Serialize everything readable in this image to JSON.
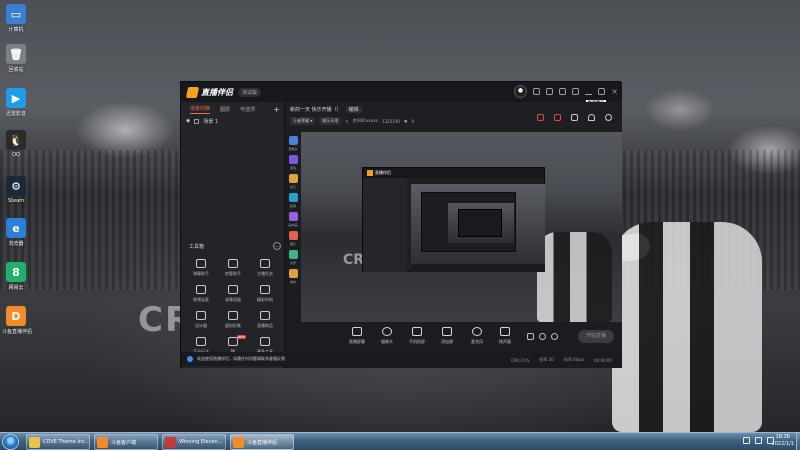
{
  "desktop": {
    "wall_text": "CRI",
    "icons": [
      {
        "label": "计算机",
        "icon": "computer-icon",
        "color": "#3b7fd4",
        "glyph": "▭"
      },
      {
        "label": "回收站",
        "icon": "recycle-bin-icon",
        "color": "#7a8088",
        "glyph": "🗑"
      },
      {
        "label": "迅雷影音",
        "icon": "media-player-icon",
        "color": "#1e9be9",
        "glyph": "▶"
      },
      {
        "label": "QQ",
        "icon": "qq-icon",
        "color": "#2b2b2b",
        "glyph": "🐧"
      },
      {
        "label": "Steam",
        "icon": "steam-icon",
        "color": "#1b2838",
        "glyph": "⚙"
      },
      {
        "label": "浏览器",
        "icon": "browser-icon",
        "color": "#2a7fd9",
        "glyph": "e"
      },
      {
        "label": "网易云",
        "icon": "netease-icon",
        "color": "#23b06b",
        "glyph": "8"
      },
      {
        "label": "斗鱼直播伴侣",
        "icon": "douyu-icon",
        "color": "#f28c28",
        "glyph": "D"
      }
    ]
  },
  "app": {
    "title": "直播伴侣",
    "version_badge": "测试版",
    "mini_badge": "新手提示",
    "accent": "#f06a5a",
    "left_tabs": [
      {
        "label": "场景切换",
        "active": true
      },
      {
        "label": "图层",
        "active": false
      },
      {
        "label": "可选项",
        "active": false
      }
    ],
    "scene_label": "场景 1",
    "tools_title": "工具箱",
    "tools": [
      {
        "label": "弹幕助手",
        "icon": "danmaku-icon"
      },
      {
        "label": "房管助手",
        "icon": "admin-icon"
      },
      {
        "label": "主播任务",
        "icon": "task-icon"
      },
      {
        "label": "视频连麦",
        "icon": "video-link-icon"
      },
      {
        "label": "录像回放",
        "icon": "replay-icon"
      },
      {
        "label": "精彩时刻",
        "icon": "highlight-icon"
      },
      {
        "label": "设计器",
        "icon": "designer-icon"
      },
      {
        "label": "虚拟形象",
        "icon": "avatar-tool-icon"
      },
      {
        "label": "直播商品",
        "icon": "goods-icon"
      },
      {
        "label": "互动玩法",
        "icon": "game-tool-icon"
      },
      {
        "label": "PK",
        "icon": "pk-icon",
        "badge": "NEW"
      },
      {
        "label": "更多工具",
        "icon": "more-tools-icon"
      }
    ],
    "notice": "欢迎使用直播伴侣，如遇任何问题请联系客服反馈",
    "room_title": "新的一天 快乐开播（）",
    "edit_label": "编辑",
    "room_chips": [
      "王者荣耀 ▾",
      "娱乐天地"
    ],
    "room_id": "房间ID:xxxxx",
    "fans": "1325190",
    "likes": "0",
    "preview_text": "CRI",
    "sources": [
      {
        "label": "摄像头",
        "color": "#4a7fe0"
      },
      {
        "label": "游戏",
        "color": "#7b59e0"
      },
      {
        "label": "窗口",
        "color": "#e0a43a"
      },
      {
        "label": "投屏",
        "color": "#2aa0c9"
      },
      {
        "label": "画中画",
        "color": "#9a5ee0"
      },
      {
        "label": "图片",
        "color": "#e2644c"
      },
      {
        "label": "文字",
        "color": "#3db38a"
      },
      {
        "label": "素材",
        "color": "#d9a23a"
      }
    ],
    "controls": [
      {
        "label": "直播屏幕",
        "icon": "screen-icon"
      },
      {
        "label": "摄像头",
        "icon": "camera-icon"
      },
      {
        "label": "手机投屏",
        "icon": "phone-cast-icon"
      },
      {
        "label": "添加源",
        "icon": "add-source-icon"
      },
      {
        "label": "麦克风",
        "icon": "microphone-icon"
      },
      {
        "label": "扬声器",
        "icon": "speaker-icon"
      }
    ],
    "start_label": "开始直播",
    "status": [
      "CPU:21%",
      "帧率:30",
      "码率:0kb/s",
      "00:00:00"
    ]
  },
  "taskbar": {
    "items": [
      {
        "label": "COVE Theme Inc...",
        "icon": "folder-icon",
        "color": "#e8c24a",
        "active": false
      },
      {
        "label": "斗鱼客户端",
        "icon": "douyu-icon",
        "color": "#f28c28",
        "active": false
      },
      {
        "label": "Winning Eleven...",
        "icon": "game-icon",
        "color": "#c23b3b",
        "active": false
      },
      {
        "label": "斗鱼直播伴侣",
        "icon": "douyu-icon",
        "color": "#f28c28",
        "active": true
      }
    ],
    "time": "18:26",
    "date": "2022/1/1"
  }
}
